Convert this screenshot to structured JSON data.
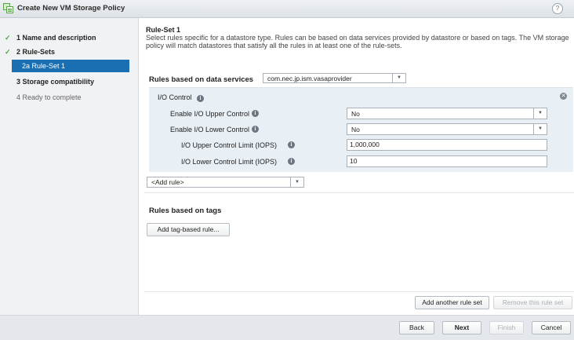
{
  "window": {
    "title": "Create New VM Storage Policy",
    "help": "?"
  },
  "steps": [
    {
      "label": "1  Name and description",
      "check": "✓"
    },
    {
      "label": "2  Rule-Sets",
      "check": "✓"
    },
    {
      "label": "2a  Rule-Set 1",
      "check": ""
    },
    {
      "label": "3  Storage compatibility",
      "check": ""
    },
    {
      "label": "4  Ready to complete",
      "check": ""
    }
  ],
  "ruleset": {
    "title": "Rule-Set 1",
    "description": "Select rules specific for a datastore type. Rules can be based on data services provided by datastore or based on tags. The VM storage policy will match datastores that satisfy all the rules in at least one of the rule-sets."
  },
  "data_services": {
    "label": "Rules based on data services",
    "provider": "com.nec.jp.ism.vasaprovider"
  },
  "io_control": {
    "title": "I/O Control",
    "fields": [
      {
        "label": "Enable I/O Upper Control",
        "value": "No"
      },
      {
        "label": "Enable I/O Lower Control",
        "value": "No"
      },
      {
        "label": "I/O Upper Control Limit (IOPS)",
        "value": "1,000,000"
      },
      {
        "label": "I/O Lower Control Limit (IOPS)",
        "value": "10"
      }
    ]
  },
  "add_rule": {
    "label": "<Add rule>"
  },
  "tags": {
    "label": "Rules based on tags",
    "add_button": "Add tag-based rule..."
  },
  "ruleset_buttons": {
    "add_another": "Add another rule set",
    "remove": "Remove this rule set"
  },
  "footer": {
    "back": "Back",
    "next": "Next",
    "finish": "Finish",
    "cancel": "Cancel"
  }
}
